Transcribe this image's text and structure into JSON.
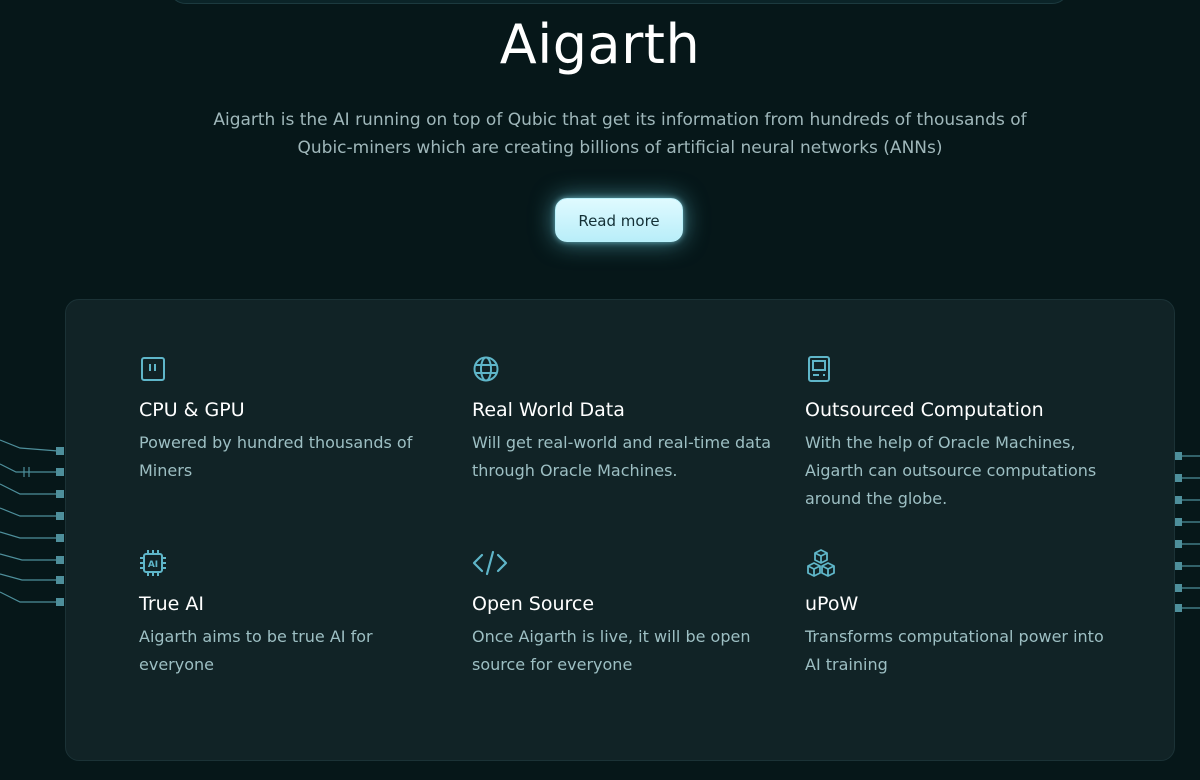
{
  "hero": {
    "title": "Aigarth",
    "subtitle": "Aigarth is the AI running on top of Qubic that get its information from hundreds of thousands of Qubic-miners which are creating billions of artificial neural networks (ANNs)",
    "button_label": "Read more"
  },
  "features": [
    {
      "icon": "chip-icon",
      "title": "CPU & GPU",
      "description": "Powered by hundred thousands of Miners"
    },
    {
      "icon": "globe-icon",
      "title": "Real World Data",
      "description": "Will get real-world and real-time data through Oracle Machines."
    },
    {
      "icon": "computer-icon",
      "title": "Outsourced Computation",
      "description": "With the help of Oracle Machines, Aigarth can outsource computations around the globe."
    },
    {
      "icon": "ai-chip-icon",
      "title": "True AI",
      "description": "Aigarth aims to be true AI for everyone"
    },
    {
      "icon": "code-icon",
      "title": "Open Source",
      "description": "Once Aigarth is live, it will be open source for everyone"
    },
    {
      "icon": "cubes-icon",
      "title": "uPoW",
      "description": "Transforms computational power into AI training"
    }
  ],
  "colors": {
    "background": "#061719",
    "panel": "#112326",
    "accent": "#5fb6c9",
    "button": "#c6f3fc"
  }
}
